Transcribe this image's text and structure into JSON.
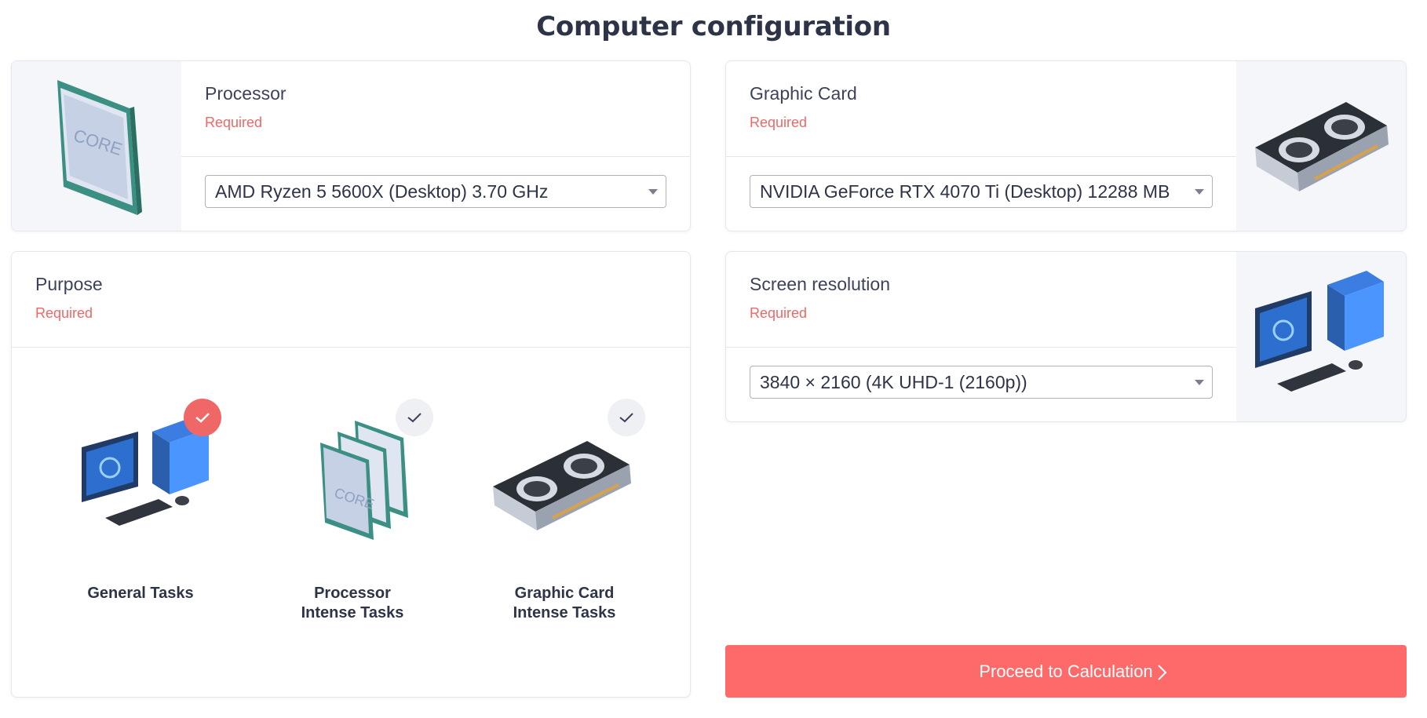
{
  "page_title": "Computer configuration",
  "processor": {
    "title": "Processor",
    "required": "Required",
    "selected": "AMD Ryzen 5 5600X (Desktop) 3.70 GHz",
    "image_icon": "cpu-chip-icon",
    "chip_text": "CORE"
  },
  "graphic_card": {
    "title": "Graphic Card",
    "required": "Required",
    "selected": "NVIDIA GeForce RTX 4070 Ti (Desktop) 12288 MB",
    "image_icon": "gpu-card-icon"
  },
  "purpose": {
    "title": "Purpose",
    "required": "Required",
    "options": [
      {
        "label": "General Tasks",
        "selected": true,
        "icon": "desktop-pc-icon"
      },
      {
        "label_line1": "Processor",
        "label_line2": "Intense Tasks",
        "selected": false,
        "icon": "cpu-stack-icon"
      },
      {
        "label_line1": "Graphic Card",
        "label_line2": "Intense Tasks",
        "selected": false,
        "icon": "gpu-card-icon"
      }
    ]
  },
  "screen_resolution": {
    "title": "Screen resolution",
    "required": "Required",
    "selected": "3840 × 2160 (4K UHD-1 (2160p))",
    "image_icon": "desktop-pc-icon"
  },
  "proceed_button": {
    "label": "Proceed to Calculation"
  },
  "colors": {
    "accent": "#fe6a6a",
    "required_text": "#f06767",
    "panel_bg": "#f4f6fa"
  }
}
